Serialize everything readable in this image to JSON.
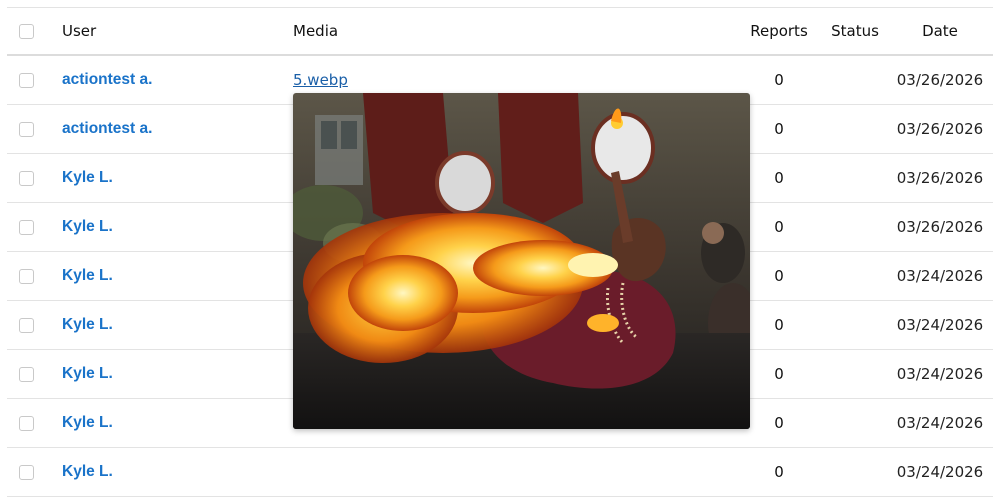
{
  "table": {
    "headers": {
      "user": "User",
      "media": "Media",
      "reports": "Reports",
      "status": "Status",
      "date": "Date"
    },
    "rows": [
      {
        "user": "actiontest a.",
        "media": "5.webp",
        "reports": "0",
        "status": "",
        "date": "03/26/2026"
      },
      {
        "user": "actiontest a.",
        "media": "",
        "reports": "0",
        "status": "",
        "date": "03/26/2026"
      },
      {
        "user": "Kyle L.",
        "media": "",
        "reports": "0",
        "status": "",
        "date": "03/26/2026"
      },
      {
        "user": "Kyle L.",
        "media": "",
        "reports": "0",
        "status": "",
        "date": "03/26/2026"
      },
      {
        "user": "Kyle L.",
        "media": "",
        "reports": "0",
        "status": "",
        "date": "03/24/2026"
      },
      {
        "user": "Kyle L.",
        "media": "",
        "reports": "0",
        "status": "",
        "date": "03/24/2026"
      },
      {
        "user": "Kyle L.",
        "media": "",
        "reports": "0",
        "status": "",
        "date": "03/24/2026"
      },
      {
        "user": "Kyle L.",
        "media": "",
        "reports": "0",
        "status": "",
        "date": "03/24/2026"
      },
      {
        "user": "Kyle L.",
        "media": "",
        "reports": "0",
        "status": "",
        "date": "03/24/2026"
      }
    ]
  },
  "preview": {
    "subject": "fire-breathing performer photo"
  },
  "colors": {
    "user_link": "#1a73c9",
    "media_link": "#1a5fa8",
    "row_border": "#e3e3e3"
  }
}
